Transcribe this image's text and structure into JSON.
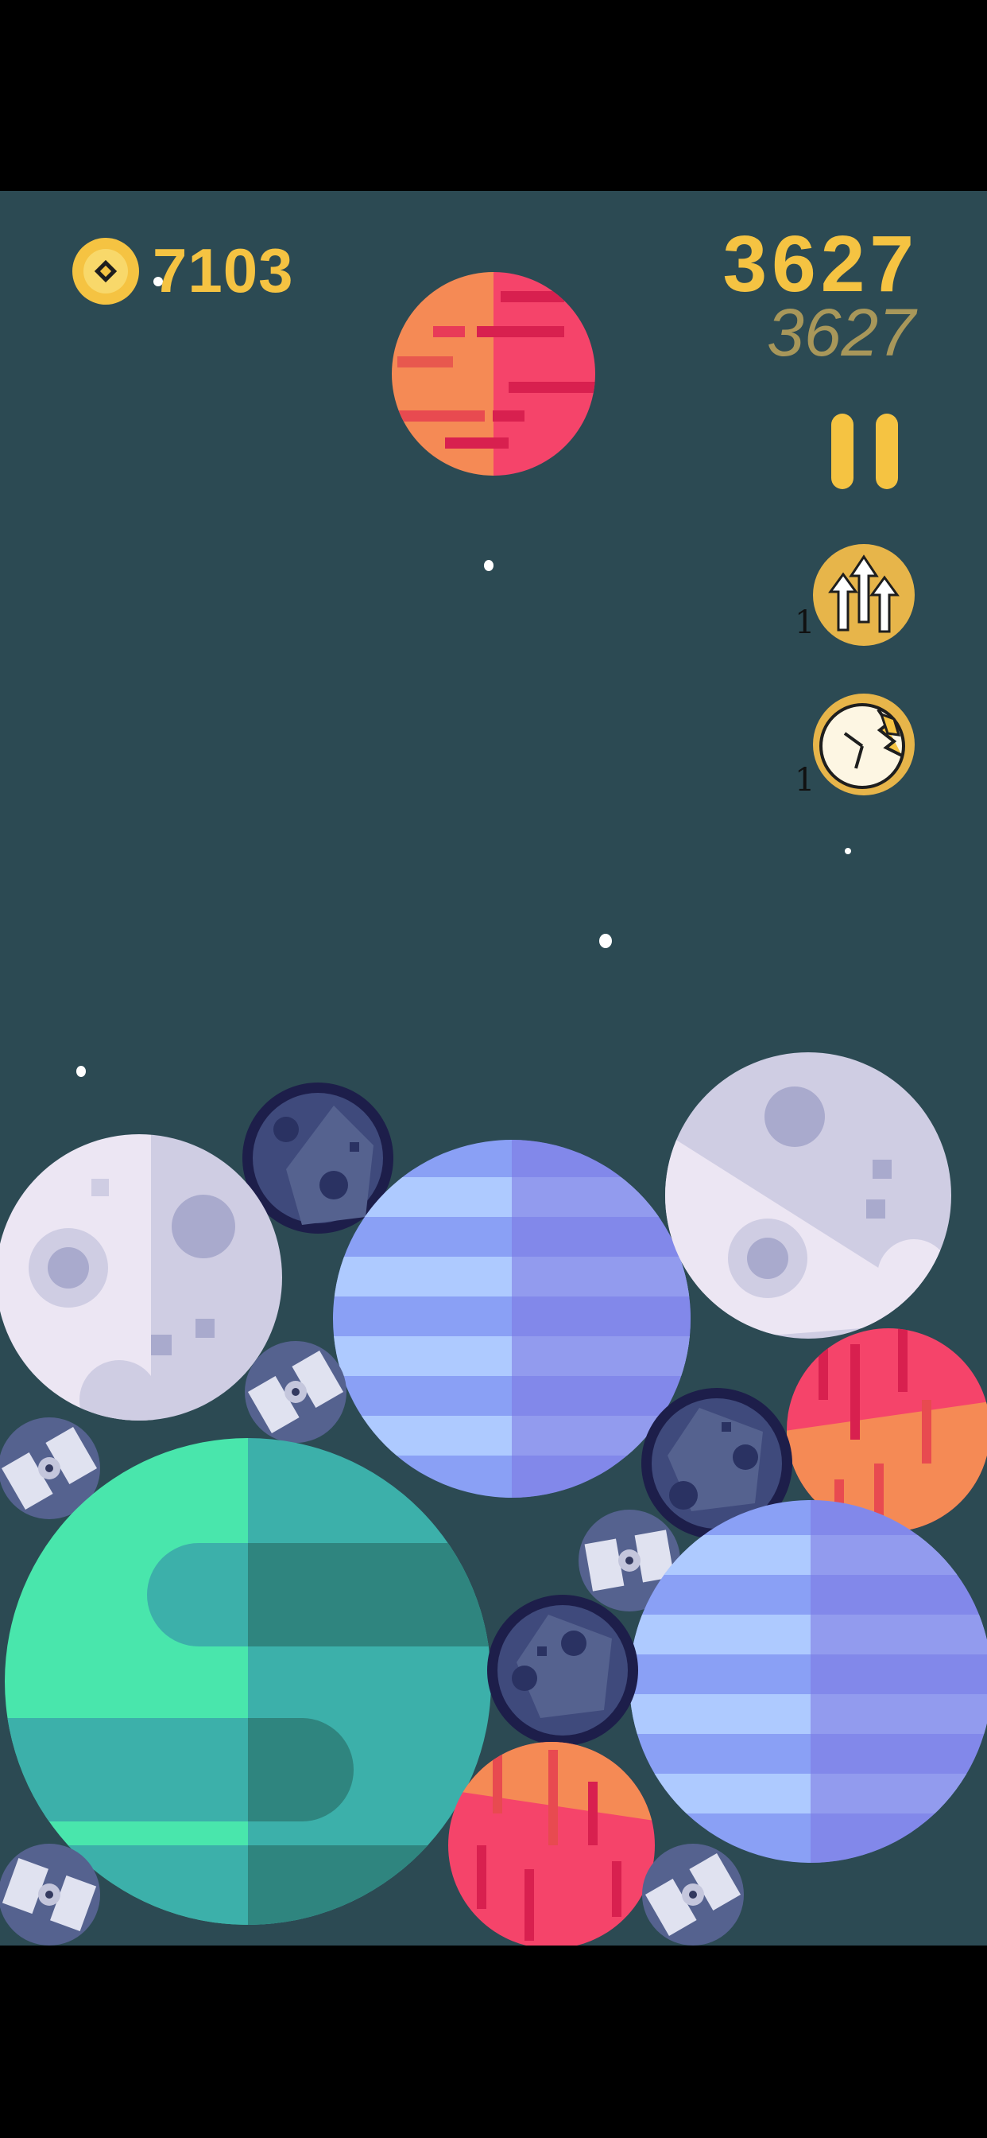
{
  "hud": {
    "coins": "7103",
    "score": "3627",
    "best_score": "3627"
  },
  "powerups": [
    {
      "name": "boost",
      "icon": "arrows-up-icon",
      "count": "1"
    },
    {
      "name": "time",
      "icon": "broken-clock-icon",
      "count": "1"
    }
  ],
  "next_planet": {
    "type": "red-orange-striped-planet"
  },
  "board_planets": [
    "moon",
    "dark-asteroid",
    "blue-striped-planet",
    "moon",
    "satellite",
    "red-orange-planet",
    "dark-asteroid",
    "satellite",
    "green-swirl-planet",
    "satellite",
    "dark-asteroid",
    "blue-striped-planet",
    "red-orange-planet",
    "satellite",
    "satellite"
  ],
  "colors": {
    "background": "#2c4a53",
    "accent": "#f5c342"
  }
}
